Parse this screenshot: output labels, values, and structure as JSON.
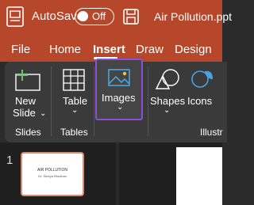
{
  "titlebar": {
    "autosave_label": "AutoSave",
    "autosave_state": "Off",
    "document_title": "Air Pollution.ppt"
  },
  "tabs": [
    {
      "label": "File"
    },
    {
      "label": "Home"
    },
    {
      "label": "Insert",
      "active": true
    },
    {
      "label": "Draw"
    },
    {
      "label": "Design"
    }
  ],
  "ribbon": {
    "new_slide": {
      "line1": "New",
      "line2": "Slide"
    },
    "table": "Table",
    "images": "Images",
    "shapes": "Shapes",
    "icons": "Icons",
    "groups": {
      "slides": "Slides",
      "tables": "Tables",
      "illustrations": "Illustr"
    }
  },
  "thumbnails": [
    {
      "number": "1",
      "title": "AIR POLLUTION",
      "subtitle": "Dr. Shreya Bhushan"
    }
  ],
  "colors": {
    "accent": "#b7472a",
    "highlight": "#8a4fd8",
    "ribbon_bg": "#3a3a3a"
  }
}
